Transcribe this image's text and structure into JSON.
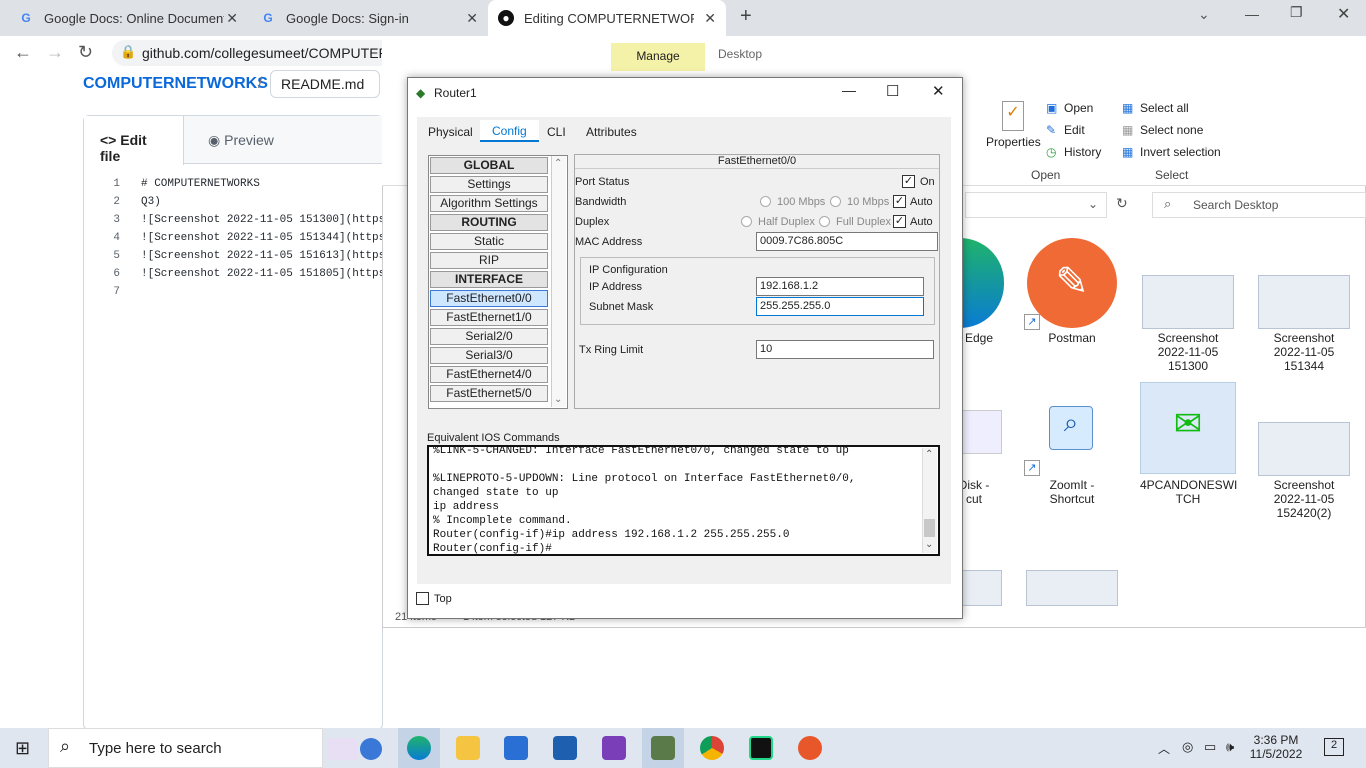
{
  "browser": {
    "tabs": [
      {
        "title": "Google Docs: Online Document E"
      },
      {
        "title": "Google Docs: Sign-in"
      },
      {
        "title": "Editing COMPUTERNETWORKS/R"
      }
    ],
    "url": "github.com/collegesumeet/COMPUTER"
  },
  "github": {
    "repo": "COMPUTERNETWORKS",
    "slash": "/",
    "file": "README.md",
    "tab_edit": "Edit file",
    "tab_preview": "Preview",
    "lines": [
      {
        "n": "1",
        "text": "# COMPUTERNETWORKS"
      },
      {
        "n": "2",
        "text": "Q3)"
      },
      {
        "n": "3",
        "text": "![Screenshot 2022-11-05 151300](https"
      },
      {
        "n": "4",
        "text": "![Screenshot 2022-11-05 151344](https"
      },
      {
        "n": "5",
        "text": "![Screenshot 2022-11-05 151613](https"
      },
      {
        "n": "6",
        "text": "![Screenshot 2022-11-05 151805](https"
      },
      {
        "n": "7",
        "text": ""
      }
    ]
  },
  "explorer": {
    "manage": "Manage",
    "desktop": "Desktop",
    "ribbon": {
      "properties": "Properties",
      "open": "Open",
      "edit": "Edit",
      "history": "History",
      "select_all": "Select all",
      "select_none": "Select none",
      "invert_selection": "Invert selection",
      "group_open": "Open",
      "group_select": "Select"
    },
    "search_placeholder": "Search Desktop",
    "status_items": "21 items",
    "status_selected": "1 item selected  127 KB",
    "icons": [
      {
        "label": "ft Edge"
      },
      {
        "label": "Postman"
      },
      {
        "label": "Screenshot\n2022-11-05\n151300"
      },
      {
        "label": "Screenshot\n2022-11-05\n151344"
      },
      {
        "label": "Disk -\ncut"
      },
      {
        "label": "ZoomIt -\nShortcut"
      },
      {
        "label": "4PCANDONESWI\nTCH"
      },
      {
        "label": "Screenshot\n2022-11-05\n152420(2)"
      }
    ]
  },
  "router": {
    "title": "Router1",
    "tabs": [
      "Physical",
      "Config",
      "CLI",
      "Attributes"
    ],
    "left_list": [
      "GLOBAL",
      "Settings",
      "Algorithm Settings",
      "ROUTING",
      "Static",
      "RIP",
      "INTERFACE",
      "FastEthernet0/0",
      "FastEthernet1/0",
      "Serial2/0",
      "Serial3/0",
      "FastEthernet4/0",
      "FastEthernet5/0"
    ],
    "panel_title": "FastEthernet0/0",
    "port_status": "Port Status",
    "on": "On",
    "bandwidth": "Bandwidth",
    "bw_100": "100 Mbps",
    "bw_10": "10 Mbps",
    "auto": "Auto",
    "duplex": "Duplex",
    "half": "Half Duplex",
    "full": "Full Duplex",
    "mac_label": "MAC Address",
    "mac": "0009.7C86.805C",
    "ip_config": "IP Configuration",
    "ip_label": "IP Address",
    "ip": "192.168.1.2",
    "mask_label": "Subnet Mask",
    "mask": "255.255.255.0",
    "tx_label": "Tx Ring Limit",
    "tx": "10",
    "ios_label": "Equivalent IOS Commands",
    "ios_text": "%LINK-5-CHANGED: Interface FastEthernet0/0, changed state to up\n\n%LINEPROTO-5-UPDOWN: Line protocol on Interface FastEthernet0/0,\nchanged state to up\nip address\n% Incomplete command.\nRouter(config-if)#ip address 192.168.1.2 255.255.255.0\nRouter(config-if)#",
    "top": "Top"
  },
  "taskbar": {
    "search": "Type here to search",
    "time": "3:36 PM",
    "date": "11/5/2022",
    "notifications": "2"
  }
}
